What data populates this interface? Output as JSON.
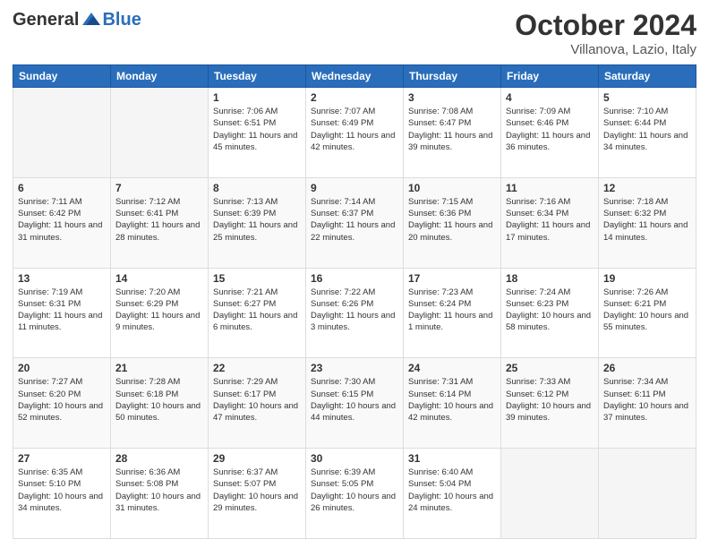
{
  "header": {
    "logo": {
      "general": "General",
      "blue": "Blue"
    },
    "title": "October 2024",
    "location": "Villanova, Lazio, Italy"
  },
  "days_of_week": [
    "Sunday",
    "Monday",
    "Tuesday",
    "Wednesday",
    "Thursday",
    "Friday",
    "Saturday"
  ],
  "weeks": [
    [
      {
        "date": "",
        "empty": true
      },
      {
        "date": "",
        "empty": true
      },
      {
        "date": "1",
        "sunrise": "Sunrise: 7:06 AM",
        "sunset": "Sunset: 6:51 PM",
        "daylight": "Daylight: 11 hours and 45 minutes."
      },
      {
        "date": "2",
        "sunrise": "Sunrise: 7:07 AM",
        "sunset": "Sunset: 6:49 PM",
        "daylight": "Daylight: 11 hours and 42 minutes."
      },
      {
        "date": "3",
        "sunrise": "Sunrise: 7:08 AM",
        "sunset": "Sunset: 6:47 PM",
        "daylight": "Daylight: 11 hours and 39 minutes."
      },
      {
        "date": "4",
        "sunrise": "Sunrise: 7:09 AM",
        "sunset": "Sunset: 6:46 PM",
        "daylight": "Daylight: 11 hours and 36 minutes."
      },
      {
        "date": "5",
        "sunrise": "Sunrise: 7:10 AM",
        "sunset": "Sunset: 6:44 PM",
        "daylight": "Daylight: 11 hours and 34 minutes."
      }
    ],
    [
      {
        "date": "6",
        "sunrise": "Sunrise: 7:11 AM",
        "sunset": "Sunset: 6:42 PM",
        "daylight": "Daylight: 11 hours and 31 minutes."
      },
      {
        "date": "7",
        "sunrise": "Sunrise: 7:12 AM",
        "sunset": "Sunset: 6:41 PM",
        "daylight": "Daylight: 11 hours and 28 minutes."
      },
      {
        "date": "8",
        "sunrise": "Sunrise: 7:13 AM",
        "sunset": "Sunset: 6:39 PM",
        "daylight": "Daylight: 11 hours and 25 minutes."
      },
      {
        "date": "9",
        "sunrise": "Sunrise: 7:14 AM",
        "sunset": "Sunset: 6:37 PM",
        "daylight": "Daylight: 11 hours and 22 minutes."
      },
      {
        "date": "10",
        "sunrise": "Sunrise: 7:15 AM",
        "sunset": "Sunset: 6:36 PM",
        "daylight": "Daylight: 11 hours and 20 minutes."
      },
      {
        "date": "11",
        "sunrise": "Sunrise: 7:16 AM",
        "sunset": "Sunset: 6:34 PM",
        "daylight": "Daylight: 11 hours and 17 minutes."
      },
      {
        "date": "12",
        "sunrise": "Sunrise: 7:18 AM",
        "sunset": "Sunset: 6:32 PM",
        "daylight": "Daylight: 11 hours and 14 minutes."
      }
    ],
    [
      {
        "date": "13",
        "sunrise": "Sunrise: 7:19 AM",
        "sunset": "Sunset: 6:31 PM",
        "daylight": "Daylight: 11 hours and 11 minutes."
      },
      {
        "date": "14",
        "sunrise": "Sunrise: 7:20 AM",
        "sunset": "Sunset: 6:29 PM",
        "daylight": "Daylight: 11 hours and 9 minutes."
      },
      {
        "date": "15",
        "sunrise": "Sunrise: 7:21 AM",
        "sunset": "Sunset: 6:27 PM",
        "daylight": "Daylight: 11 hours and 6 minutes."
      },
      {
        "date": "16",
        "sunrise": "Sunrise: 7:22 AM",
        "sunset": "Sunset: 6:26 PM",
        "daylight": "Daylight: 11 hours and 3 minutes."
      },
      {
        "date": "17",
        "sunrise": "Sunrise: 7:23 AM",
        "sunset": "Sunset: 6:24 PM",
        "daylight": "Daylight: 11 hours and 1 minute."
      },
      {
        "date": "18",
        "sunrise": "Sunrise: 7:24 AM",
        "sunset": "Sunset: 6:23 PM",
        "daylight": "Daylight: 10 hours and 58 minutes."
      },
      {
        "date": "19",
        "sunrise": "Sunrise: 7:26 AM",
        "sunset": "Sunset: 6:21 PM",
        "daylight": "Daylight: 10 hours and 55 minutes."
      }
    ],
    [
      {
        "date": "20",
        "sunrise": "Sunrise: 7:27 AM",
        "sunset": "Sunset: 6:20 PM",
        "daylight": "Daylight: 10 hours and 52 minutes."
      },
      {
        "date": "21",
        "sunrise": "Sunrise: 7:28 AM",
        "sunset": "Sunset: 6:18 PM",
        "daylight": "Daylight: 10 hours and 50 minutes."
      },
      {
        "date": "22",
        "sunrise": "Sunrise: 7:29 AM",
        "sunset": "Sunset: 6:17 PM",
        "daylight": "Daylight: 10 hours and 47 minutes."
      },
      {
        "date": "23",
        "sunrise": "Sunrise: 7:30 AM",
        "sunset": "Sunset: 6:15 PM",
        "daylight": "Daylight: 10 hours and 44 minutes."
      },
      {
        "date": "24",
        "sunrise": "Sunrise: 7:31 AM",
        "sunset": "Sunset: 6:14 PM",
        "daylight": "Daylight: 10 hours and 42 minutes."
      },
      {
        "date": "25",
        "sunrise": "Sunrise: 7:33 AM",
        "sunset": "Sunset: 6:12 PM",
        "daylight": "Daylight: 10 hours and 39 minutes."
      },
      {
        "date": "26",
        "sunrise": "Sunrise: 7:34 AM",
        "sunset": "Sunset: 6:11 PM",
        "daylight": "Daylight: 10 hours and 37 minutes."
      }
    ],
    [
      {
        "date": "27",
        "sunrise": "Sunrise: 6:35 AM",
        "sunset": "Sunset: 5:10 PM",
        "daylight": "Daylight: 10 hours and 34 minutes."
      },
      {
        "date": "28",
        "sunrise": "Sunrise: 6:36 AM",
        "sunset": "Sunset: 5:08 PM",
        "daylight": "Daylight: 10 hours and 31 minutes."
      },
      {
        "date": "29",
        "sunrise": "Sunrise: 6:37 AM",
        "sunset": "Sunset: 5:07 PM",
        "daylight": "Daylight: 10 hours and 29 minutes."
      },
      {
        "date": "30",
        "sunrise": "Sunrise: 6:39 AM",
        "sunset": "Sunset: 5:05 PM",
        "daylight": "Daylight: 10 hours and 26 minutes."
      },
      {
        "date": "31",
        "sunrise": "Sunrise: 6:40 AM",
        "sunset": "Sunset: 5:04 PM",
        "daylight": "Daylight: 10 hours and 24 minutes."
      },
      {
        "date": "",
        "empty": true
      },
      {
        "date": "",
        "empty": true
      }
    ]
  ]
}
